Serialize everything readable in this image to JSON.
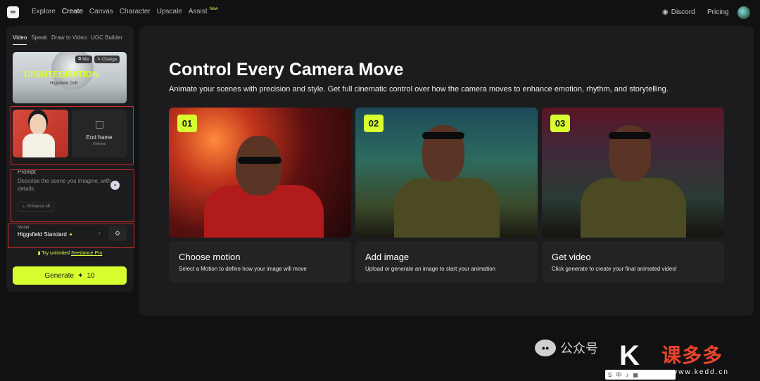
{
  "nav": {
    "items": [
      "Explore",
      "Create",
      "Canvas",
      "Character",
      "Upscale",
      "Assist"
    ],
    "assist_badge": "New",
    "discord": "Discord",
    "pricing": "Pricing"
  },
  "left": {
    "tabs": [
      "Video",
      "Speak",
      "Draw to Video",
      "UGC Builder"
    ],
    "motion": {
      "title": "DISINTEGRATION",
      "subtitle": "Higgsfield DoP",
      "mix": "Mix",
      "change": "Change"
    },
    "end_frame": {
      "label": "End frame",
      "optional": "Optional"
    },
    "prompt": {
      "label": "Prompt",
      "placeholder": "Describe the scene you imagine, with details.",
      "enhance": "Enhance off"
    },
    "model": {
      "label": "Model",
      "value": "Higgsfield Standard"
    },
    "try_text": "Try unlimited",
    "try_link": "Seedance Pro",
    "generate": {
      "label": "Generate",
      "cost": "10"
    }
  },
  "main": {
    "title": "Control Every Camera Move",
    "subtitle": "Animate your scenes with precision and style. Get full cinematic control over how the camera moves to enhance emotion, rhythm, and storytelling.",
    "cards": [
      {
        "num": "01",
        "title": "Choose motion",
        "desc": "Select a Motion to define how your image will move"
      },
      {
        "num": "02",
        "title": "Add image",
        "desc": "Upload or generate an image to start your animation"
      },
      {
        "num": "03",
        "title": "Get video",
        "desc": "Click generate to create your final animated video!"
      }
    ]
  },
  "watermark": {
    "text": "公众号",
    "brand": "课多多",
    "url": "www.kedd.cn"
  },
  "colors": {
    "accent": "#d7ff2f",
    "highlight": "#d12b2b",
    "panel": "#1c1c1e"
  }
}
